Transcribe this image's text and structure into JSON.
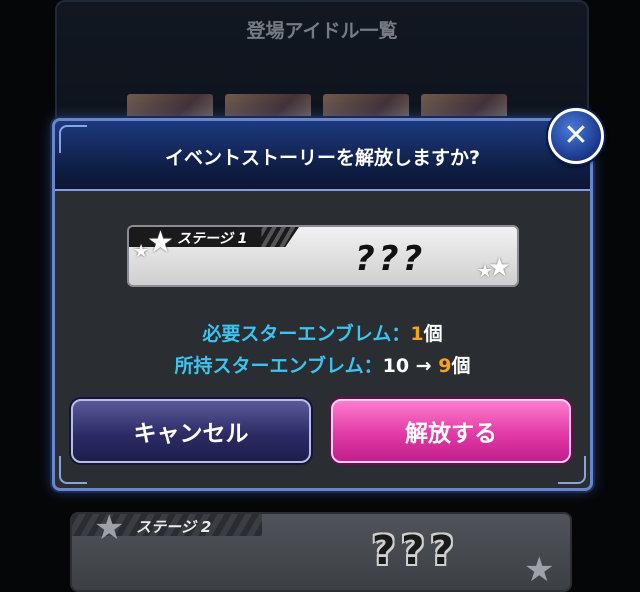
{
  "background": {
    "title": "登場アイドル一覧",
    "stage2": {
      "label": "ステージ 2",
      "value": "???"
    }
  },
  "dialog": {
    "title": "イベントストーリーを解放しますか?",
    "stage": {
      "label": "ステージ 1",
      "value": "???"
    },
    "required": {
      "label": "必要スターエンブレム：",
      "count": "1",
      "unit": "個"
    },
    "owned": {
      "label": "所持スターエンブレム：",
      "before": "10",
      "arrow": "→",
      "after": "9",
      "unit": "個"
    },
    "buttons": {
      "cancel": "キャンセル",
      "unlock": "解放する"
    },
    "close_glyph": "✕"
  },
  "colors": {
    "accent_blue": "#3cc4f0",
    "accent_orange": "#f5a21c",
    "unlock_pink": "#e23aa6",
    "cancel_navy": "#2c2c66"
  }
}
